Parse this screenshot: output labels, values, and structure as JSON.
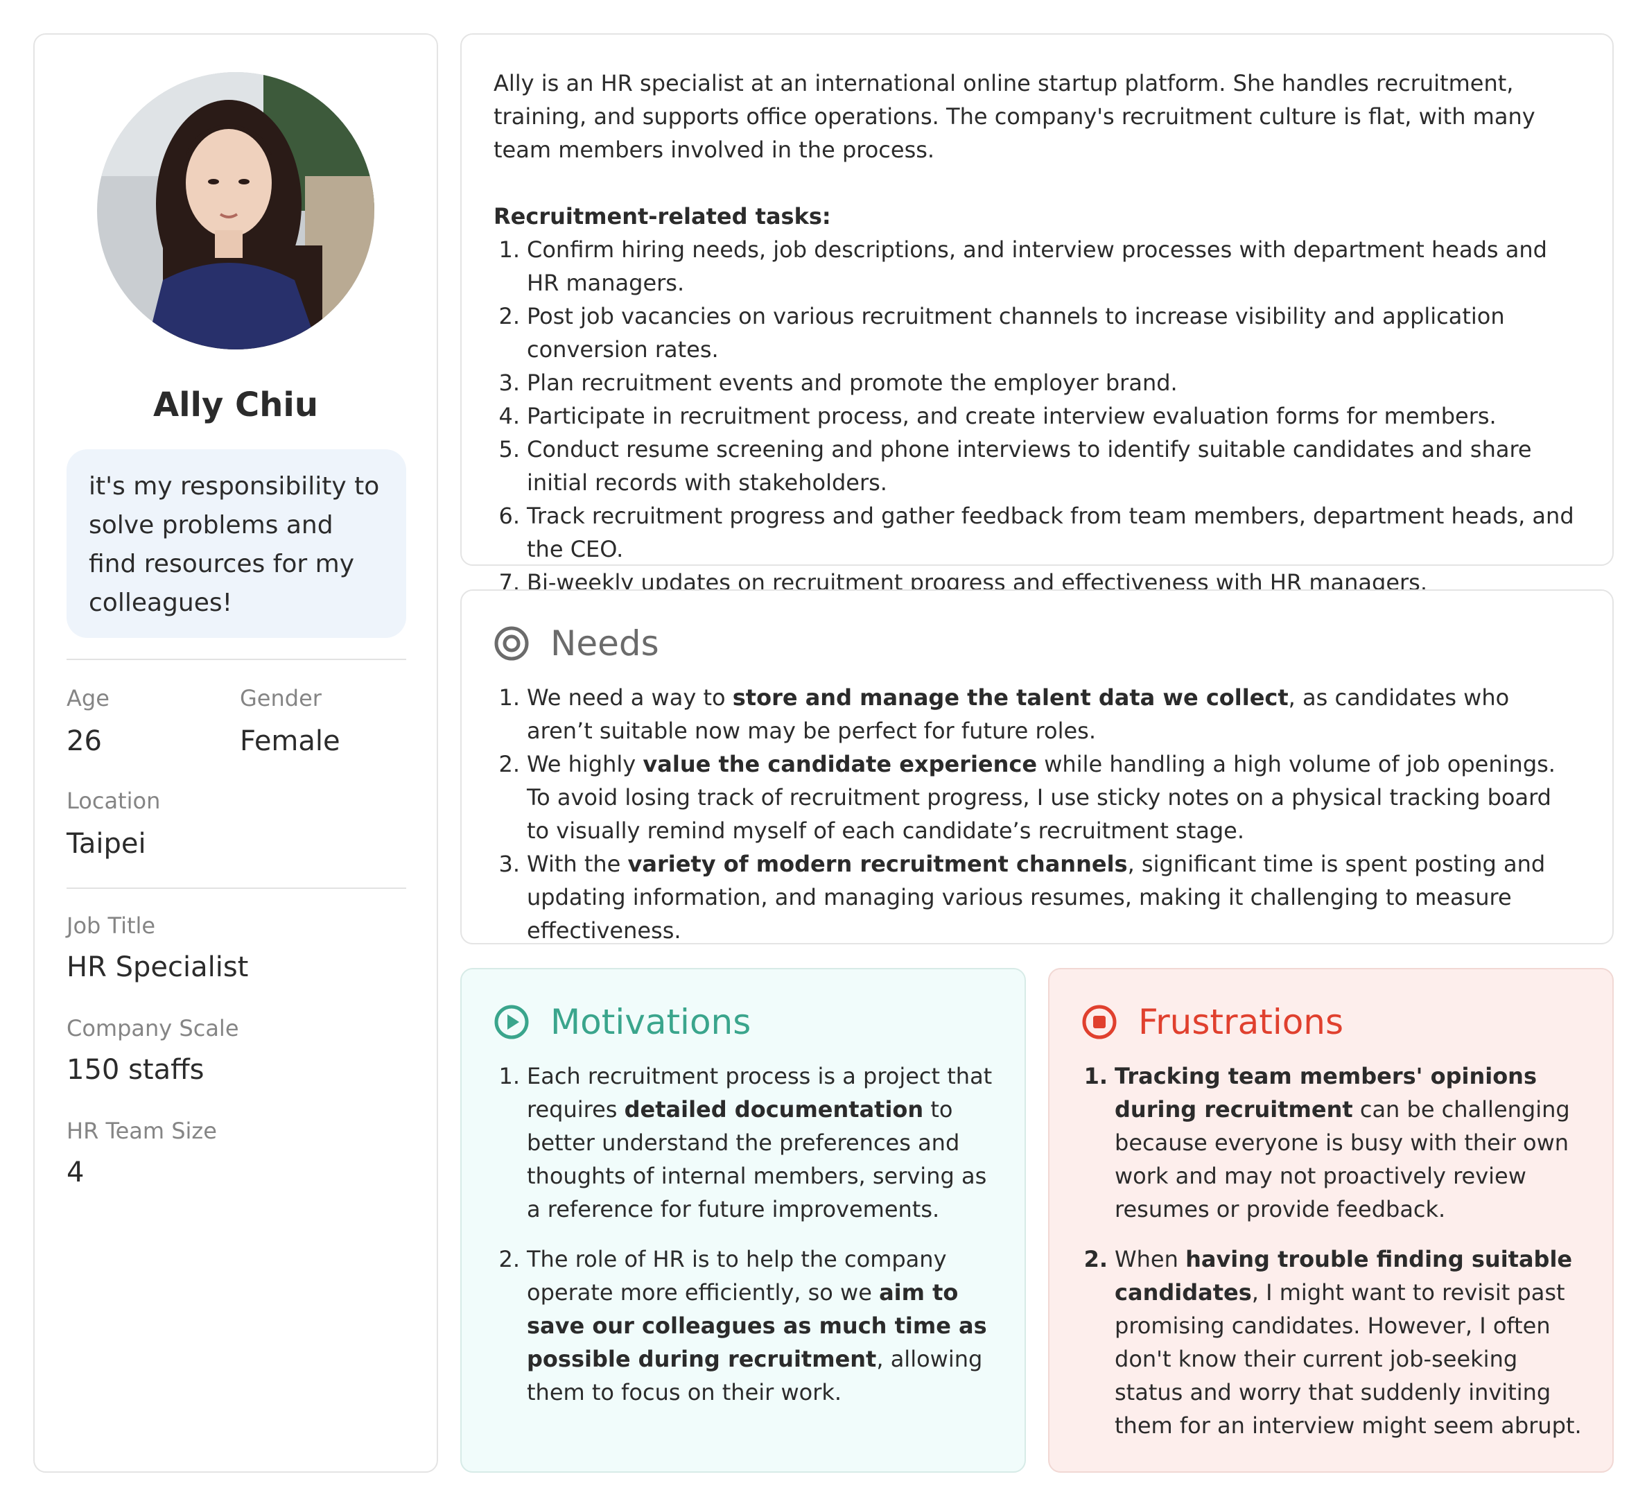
{
  "profile": {
    "name": "Ally Chiu",
    "quote": "it's my responsibility to solve problems and find resources for my colleagues!",
    "age_label": "Age",
    "age": "26",
    "gender_label": "Gender",
    "gender": "Female",
    "location_label": "Location",
    "location": "Taipei",
    "job_title_label": "Job Title",
    "job_title": "HR Specialist",
    "company_scale_label": "Company Scale",
    "company_scale": "150 staffs",
    "team_size_label": "HR Team Size",
    "team_size": "4"
  },
  "about": {
    "intro": "Ally is an HR specialist at an international online startup platform. She handles recruitment, training, and supports office operations. The company's recruitment culture is flat, with many team members involved in the process.",
    "tasks_heading": "Recruitment-related tasks:",
    "tasks": [
      "Confirm hiring needs, job descriptions, and interview processes with department heads and HR managers.",
      "Post job vacancies on various recruitment channels to increase visibility and application conversion rates.",
      "Plan recruitment events and promote the employer brand.",
      "Participate in recruitment process, and create interview evaluation forms for members.",
      "Conduct resume screening and phone interviews to identify suitable candidates and share initial records with stakeholders.",
      "Track recruitment progress and gather feedback from team members, department heads, and the CEO.",
      "Bi-weekly updates on recruitment progress and effectiveness with HR managers."
    ]
  },
  "needs": {
    "title": "Needs",
    "items": [
      {
        "pre": "We need a way to ",
        "bold": "store and manage the talent data we collect",
        "post": ", as candidates who aren’t suitable now may be perfect for future roles."
      },
      {
        "pre": "We highly ",
        "bold": "value the candidate experience",
        "post": " while handling a high volume of job openings. To avoid losing track of recruitment progress, I use sticky notes on a physical tracking board to visually remind myself of each candidate’s recruitment stage."
      },
      {
        "pre": "With the ",
        "bold": "variety of modern recruitment channels",
        "post": ", significant time is spent posting and updating information, and managing various resumes, making it challenging to measure effectiveness."
      }
    ]
  },
  "motivations": {
    "title": "Motivations",
    "items": [
      {
        "pre": "Each recruitment process is a project that requires ",
        "bold": "detailed documentation",
        "post": " to better understand the preferences and thoughts of internal members, serving as a reference for future improvements."
      },
      {
        "pre": "The role of HR is to help the company operate more efficiently, so we ",
        "bold": "aim to save our colleagues as much time as possible during recruitment",
        "post": ", allowing them to focus on their work."
      }
    ]
  },
  "frustrations": {
    "title": "Frustrations",
    "items": [
      {
        "pre": "",
        "bold": "Tracking team members' opinions during recruitment",
        "post": " can be challenging because everyone is busy with their own work and may not proactively review resumes or provide feedback."
      },
      {
        "pre": "When ",
        "bold": "having trouble finding suitable candidates",
        "post": ", I might want to revisit past promising candidates. However, I often don't know their current job-seeking status and worry that suddenly inviting them for an interview might seem abrupt."
      }
    ]
  },
  "colors": {
    "needs": "#6b6b6b",
    "motivations": "#3aa58c",
    "frustrations": "#e0402e"
  },
  "icons": {
    "needs": "target-icon",
    "motivations": "play-circle-icon",
    "frustrations": "stop-circle-icon"
  }
}
